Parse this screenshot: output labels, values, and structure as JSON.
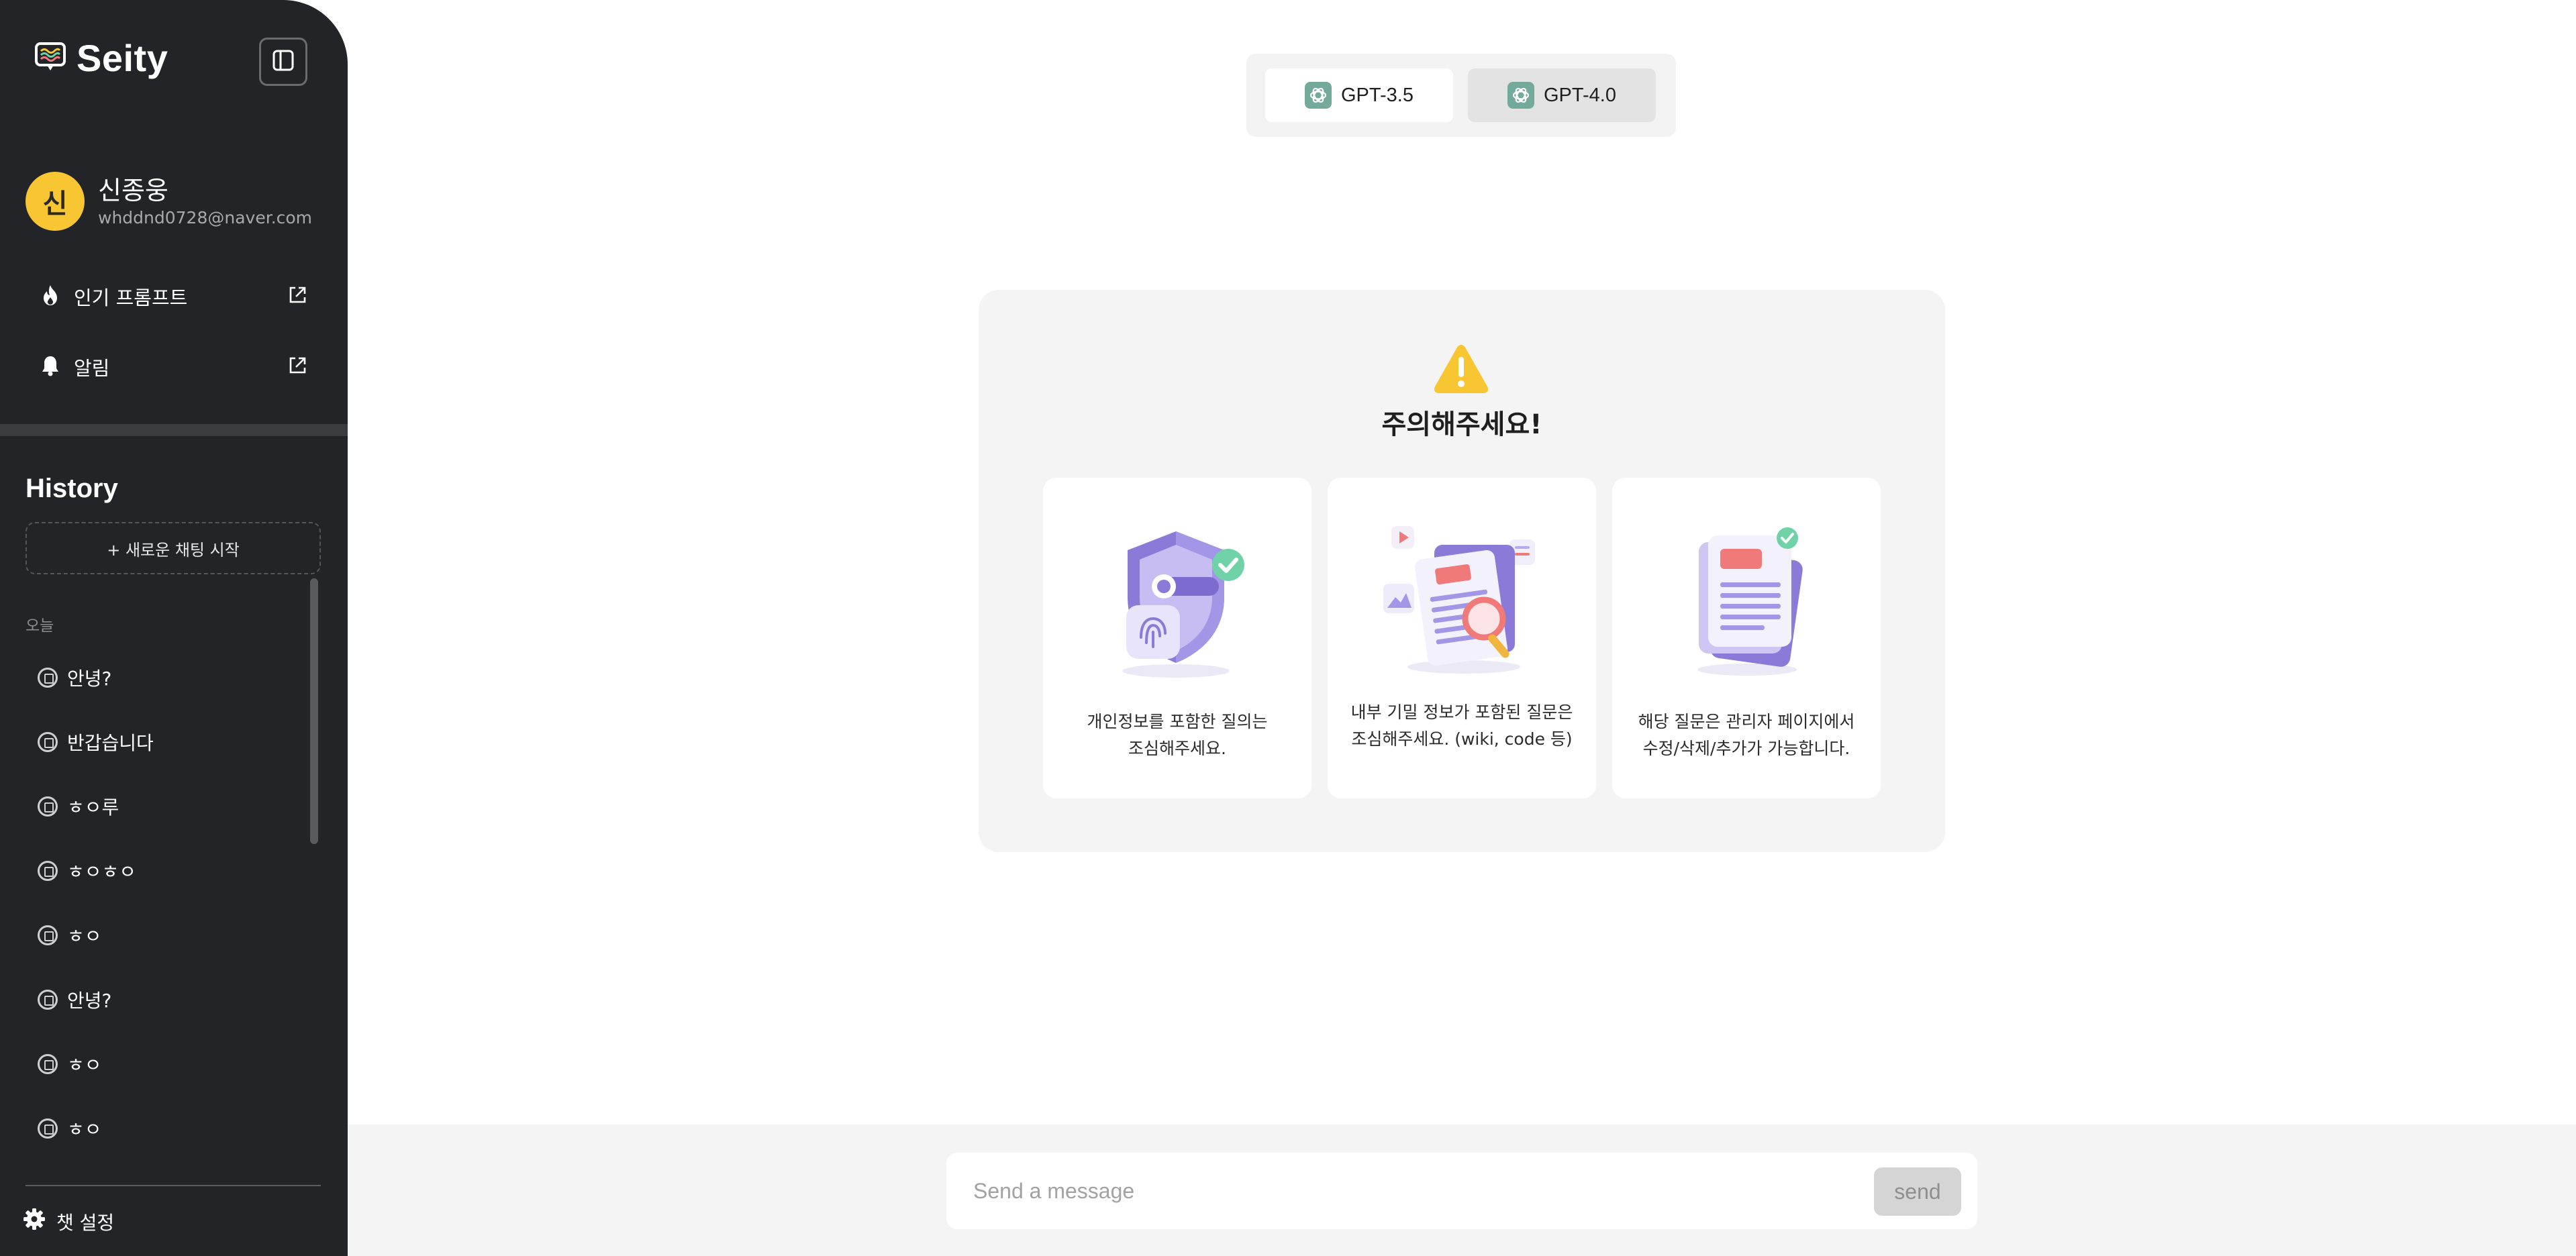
{
  "app": {
    "name": "Seity"
  },
  "profile": {
    "initial": "신",
    "name": "신종웅",
    "email": "whddnd0728@naver.com"
  },
  "side_links": [
    {
      "label": "인기 프롬프트",
      "icon": "fire-icon"
    },
    {
      "label": "알림",
      "icon": "bell-icon"
    }
  ],
  "history": {
    "title": "History",
    "new_chat_label": "+ 새로운 채팅 시작",
    "group_label": "오늘",
    "items": [
      {
        "label": "안녕?"
      },
      {
        "label": "반갑습니다"
      },
      {
        "label": "ㅎㅇ루"
      },
      {
        "label": "ㅎㅇㅎㅇ"
      },
      {
        "label": "ㅎㅇ"
      },
      {
        "label": "안녕?"
      },
      {
        "label": "ㅎㅇ"
      },
      {
        "label": "ㅎㅇ"
      }
    ]
  },
  "settings": {
    "label": "챗 설정"
  },
  "models": [
    {
      "label": "GPT-3.5",
      "selected": false
    },
    {
      "label": "GPT-4.0",
      "selected": true
    }
  ],
  "warning": {
    "title": "주의해주세요!",
    "cards": [
      {
        "text": "개인정보를 포함한 질의는\n조심해주세요.",
        "illustration": "shield-fingerprint-illustration"
      },
      {
        "text": "내부 기밀 정보가 포함된 질문은\n조심해주세요. (wiki, code 등)",
        "illustration": "document-search-illustration"
      },
      {
        "text": "해당 질문은 관리자 페이지에서\n수정/삭제/추가가 가능합니다.",
        "illustration": "documents-stack-illustration"
      }
    ]
  },
  "composer": {
    "placeholder": "Send a message",
    "send_label": "send"
  },
  "colors": {
    "sidebar_bg": "#232427",
    "accent_yellow": "#f7c632",
    "illustration_purple": "#8b7ad8"
  }
}
